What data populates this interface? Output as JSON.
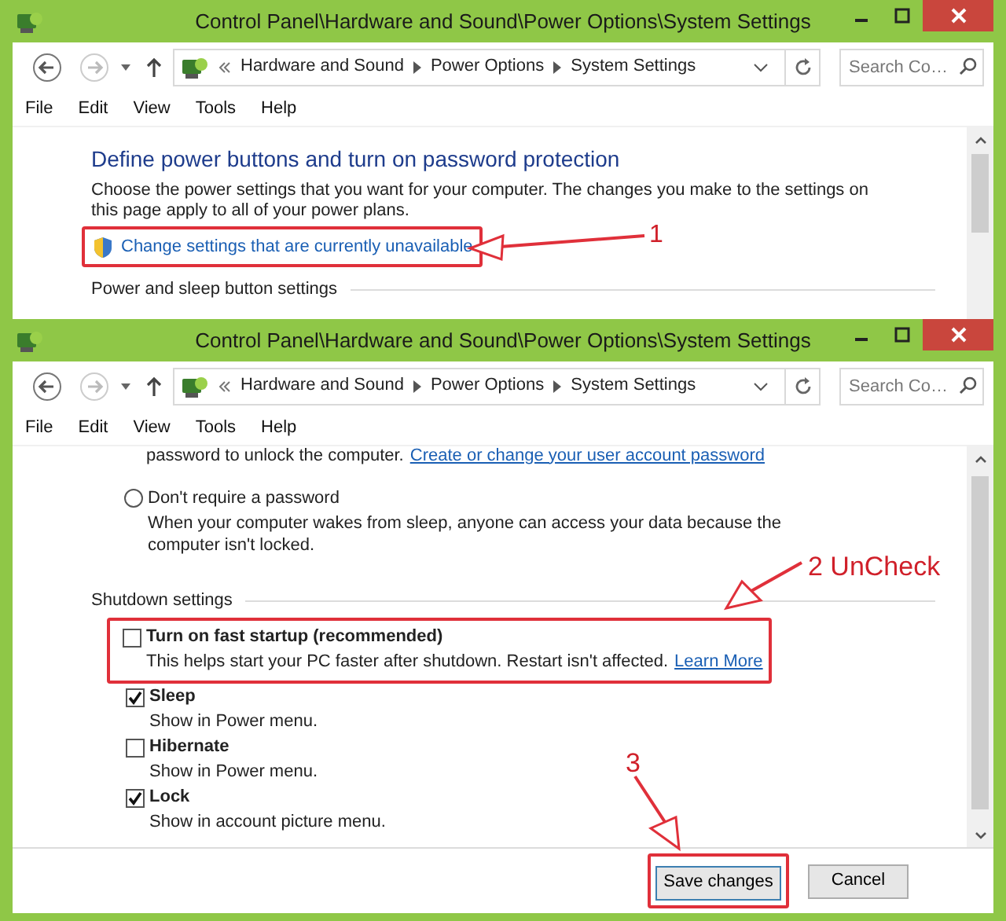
{
  "windows": [
    {
      "title": "Control Panel\\Hardware and Sound\\Power Options\\System Settings",
      "breadcrumbs": [
        "Hardware and Sound",
        "Power Options",
        "System Settings"
      ],
      "search": {
        "placeholder": "Search Co…"
      },
      "menu": [
        "File",
        "Edit",
        "View",
        "Tools",
        "Help"
      ],
      "heading": "Define power buttons and turn on password protection",
      "description": "Choose the power settings that you want for your computer. The changes you make to the settings on this page apply to all of your power plans.",
      "link": "Change settings that are currently unavailable",
      "section": "Power and sleep button settings"
    },
    {
      "title": "Control Panel\\Hardware and Sound\\Power Options\\System Settings",
      "breadcrumbs": [
        "Hardware and Sound",
        "Power Options",
        "System Settings"
      ],
      "search": {
        "placeholder": "Search Co…"
      },
      "menu": [
        "File",
        "Edit",
        "View",
        "Tools",
        "Help"
      ],
      "partial_text": "password to unlock the computer.",
      "password_link": "Create or change your user account password",
      "radio": {
        "label": "Don't require a password",
        "description": "When your computer wakes from sleep, anyone can access your data because the computer isn't locked.",
        "selected": false
      },
      "section": "Shutdown settings",
      "options": [
        {
          "label": "Turn on fast startup (recommended)",
          "description": "This helps start your PC faster after shutdown. Restart isn't affected.",
          "link": "Learn More",
          "checked": false
        },
        {
          "label": "Sleep",
          "description": "Show in Power menu.",
          "checked": true
        },
        {
          "label": "Hibernate",
          "description": "Show in Power menu.",
          "checked": false
        },
        {
          "label": "Lock",
          "description": "Show in account picture menu.",
          "checked": true
        }
      ],
      "buttons": [
        "Save changes",
        "Cancel"
      ]
    }
  ],
  "annotations": [
    "1",
    "2 UnCheck",
    "3"
  ]
}
